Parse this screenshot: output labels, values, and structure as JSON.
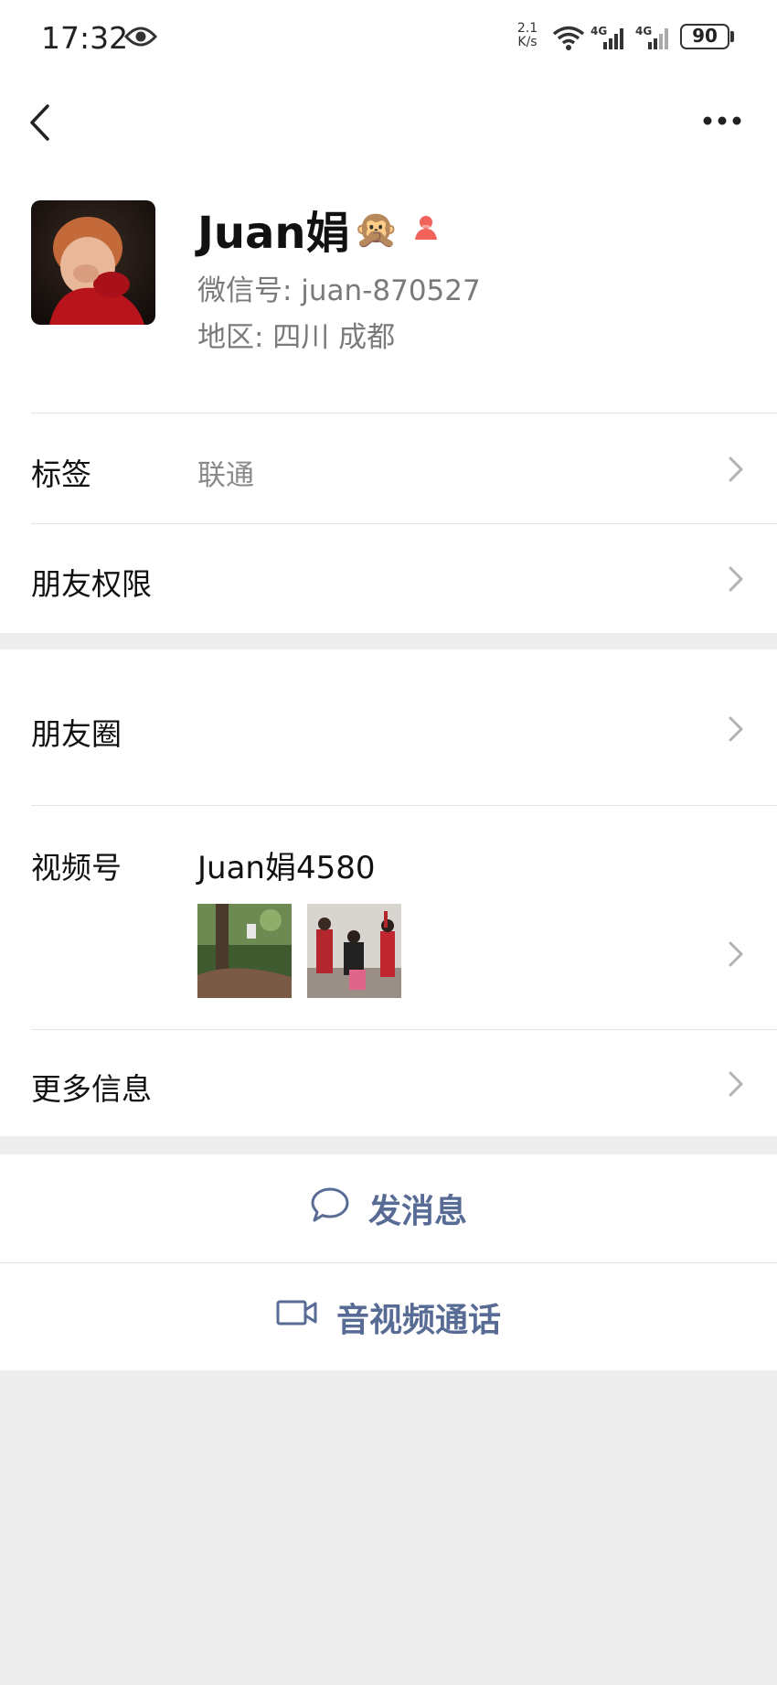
{
  "status_bar": {
    "time": "17:32",
    "speed_value": "2.1",
    "speed_unit": "K/s",
    "signal1_label": "4G",
    "signal2_label": "4G",
    "battery": "90"
  },
  "profile": {
    "name": "Juan娟",
    "emoji": "🙊",
    "wechat_id": "微信号: juan-870527",
    "region": "地区: 四川  成都"
  },
  "rows": {
    "tags_label": "标签",
    "tags_value": "联通",
    "permissions_label": "朋友权限",
    "moments_label": "朋友圈",
    "channels_label": "视频号",
    "channels_name": "Juan娟4580",
    "more_label": "更多信息"
  },
  "actions": {
    "message": "发消息",
    "call": "音视频通话"
  },
  "colors": {
    "accent_link": "#576b95",
    "gender_icon": "#f0625a",
    "background": "#ededed"
  }
}
